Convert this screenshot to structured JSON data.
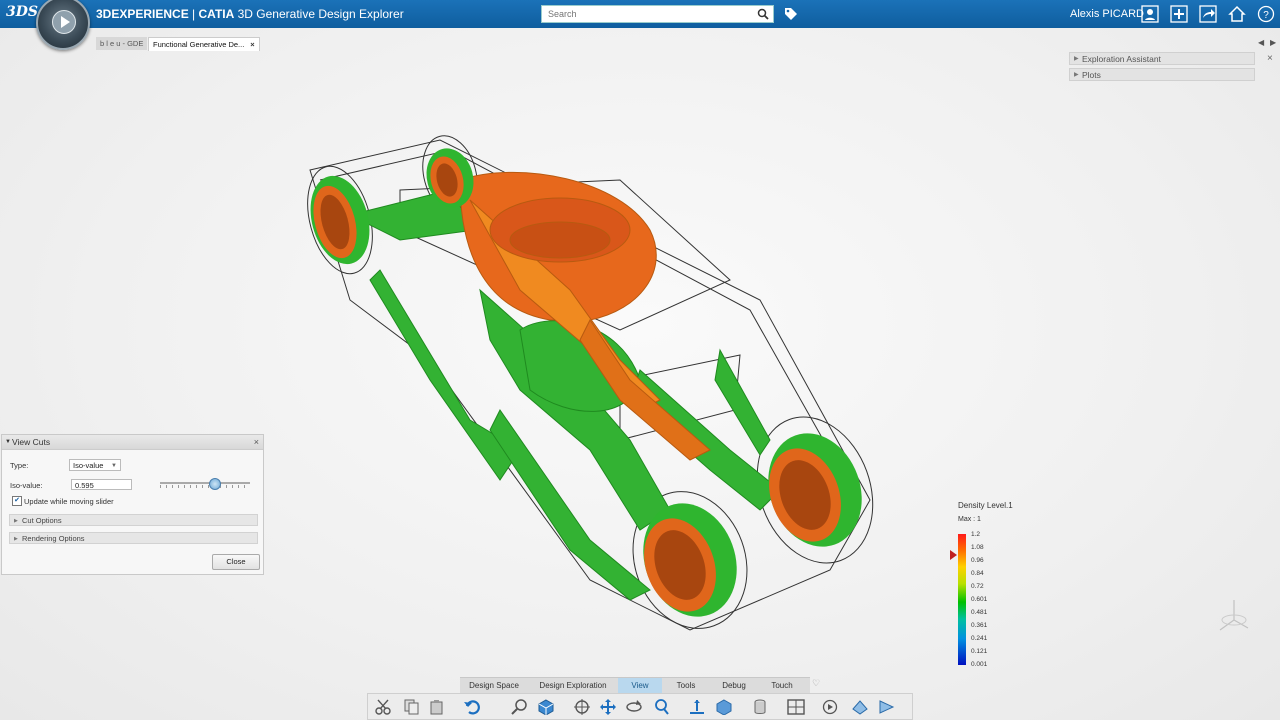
{
  "topbar": {
    "logo": "3DS",
    "title_brand": "3DEXPERIENCE",
    "title_sep": " | ",
    "title_app_bold": "CATIA",
    "title_app": " 3D Generative Design Explorer",
    "search_placeholder": "Search",
    "user": "Alexis PICARD",
    "accent": "#1567ab"
  },
  "tabs": [
    {
      "label": "b l e u - GDE"
    },
    {
      "label": "Functional Generative De...",
      "close": "×"
    }
  ],
  "right_panel": {
    "items": [
      {
        "label": "Exploration Assistant"
      },
      {
        "label": "Plots"
      }
    ]
  },
  "view_cuts": {
    "title": "View Cuts",
    "close_x": "×",
    "type_label": "Type:",
    "type_value": "Iso-value",
    "iso_label": "Iso-value:",
    "iso_value": "0.595",
    "iso_slider_fraction": 0.595,
    "update_label": "Update while moving slider",
    "update_checked": true,
    "cut_options": "Cut Options",
    "rendering_options": "Rendering Options",
    "close_button": "Close"
  },
  "legend": {
    "title": "Density Level.1",
    "max": "Max : 1",
    "ticks": [
      "1.2",
      "1.08",
      "0.96",
      "0.84",
      "0.72",
      "0.601",
      "0.481",
      "0.361",
      "0.241",
      "0.121",
      "0.001"
    ]
  },
  "action_tabs": {
    "items": [
      {
        "label": "Design Space"
      },
      {
        "label": "Design Exploration"
      },
      {
        "label": "View",
        "active": true
      },
      {
        "label": "Tools"
      },
      {
        "label": "Debug"
      },
      {
        "label": "Touch"
      }
    ]
  },
  "toolbar_icons": [
    "cut-icon",
    "copy-icon",
    "paste-icon",
    "undo-icon",
    "zoom-area-icon",
    "view-cube-icon",
    "center-icon",
    "pan-icon",
    "rotate-icon",
    "zoom-icon",
    "normal-view-icon",
    "render-style-icon",
    "cylinder-icon",
    "layout-icon",
    "play-icon",
    "section-icon",
    "view-cut-icon"
  ]
}
